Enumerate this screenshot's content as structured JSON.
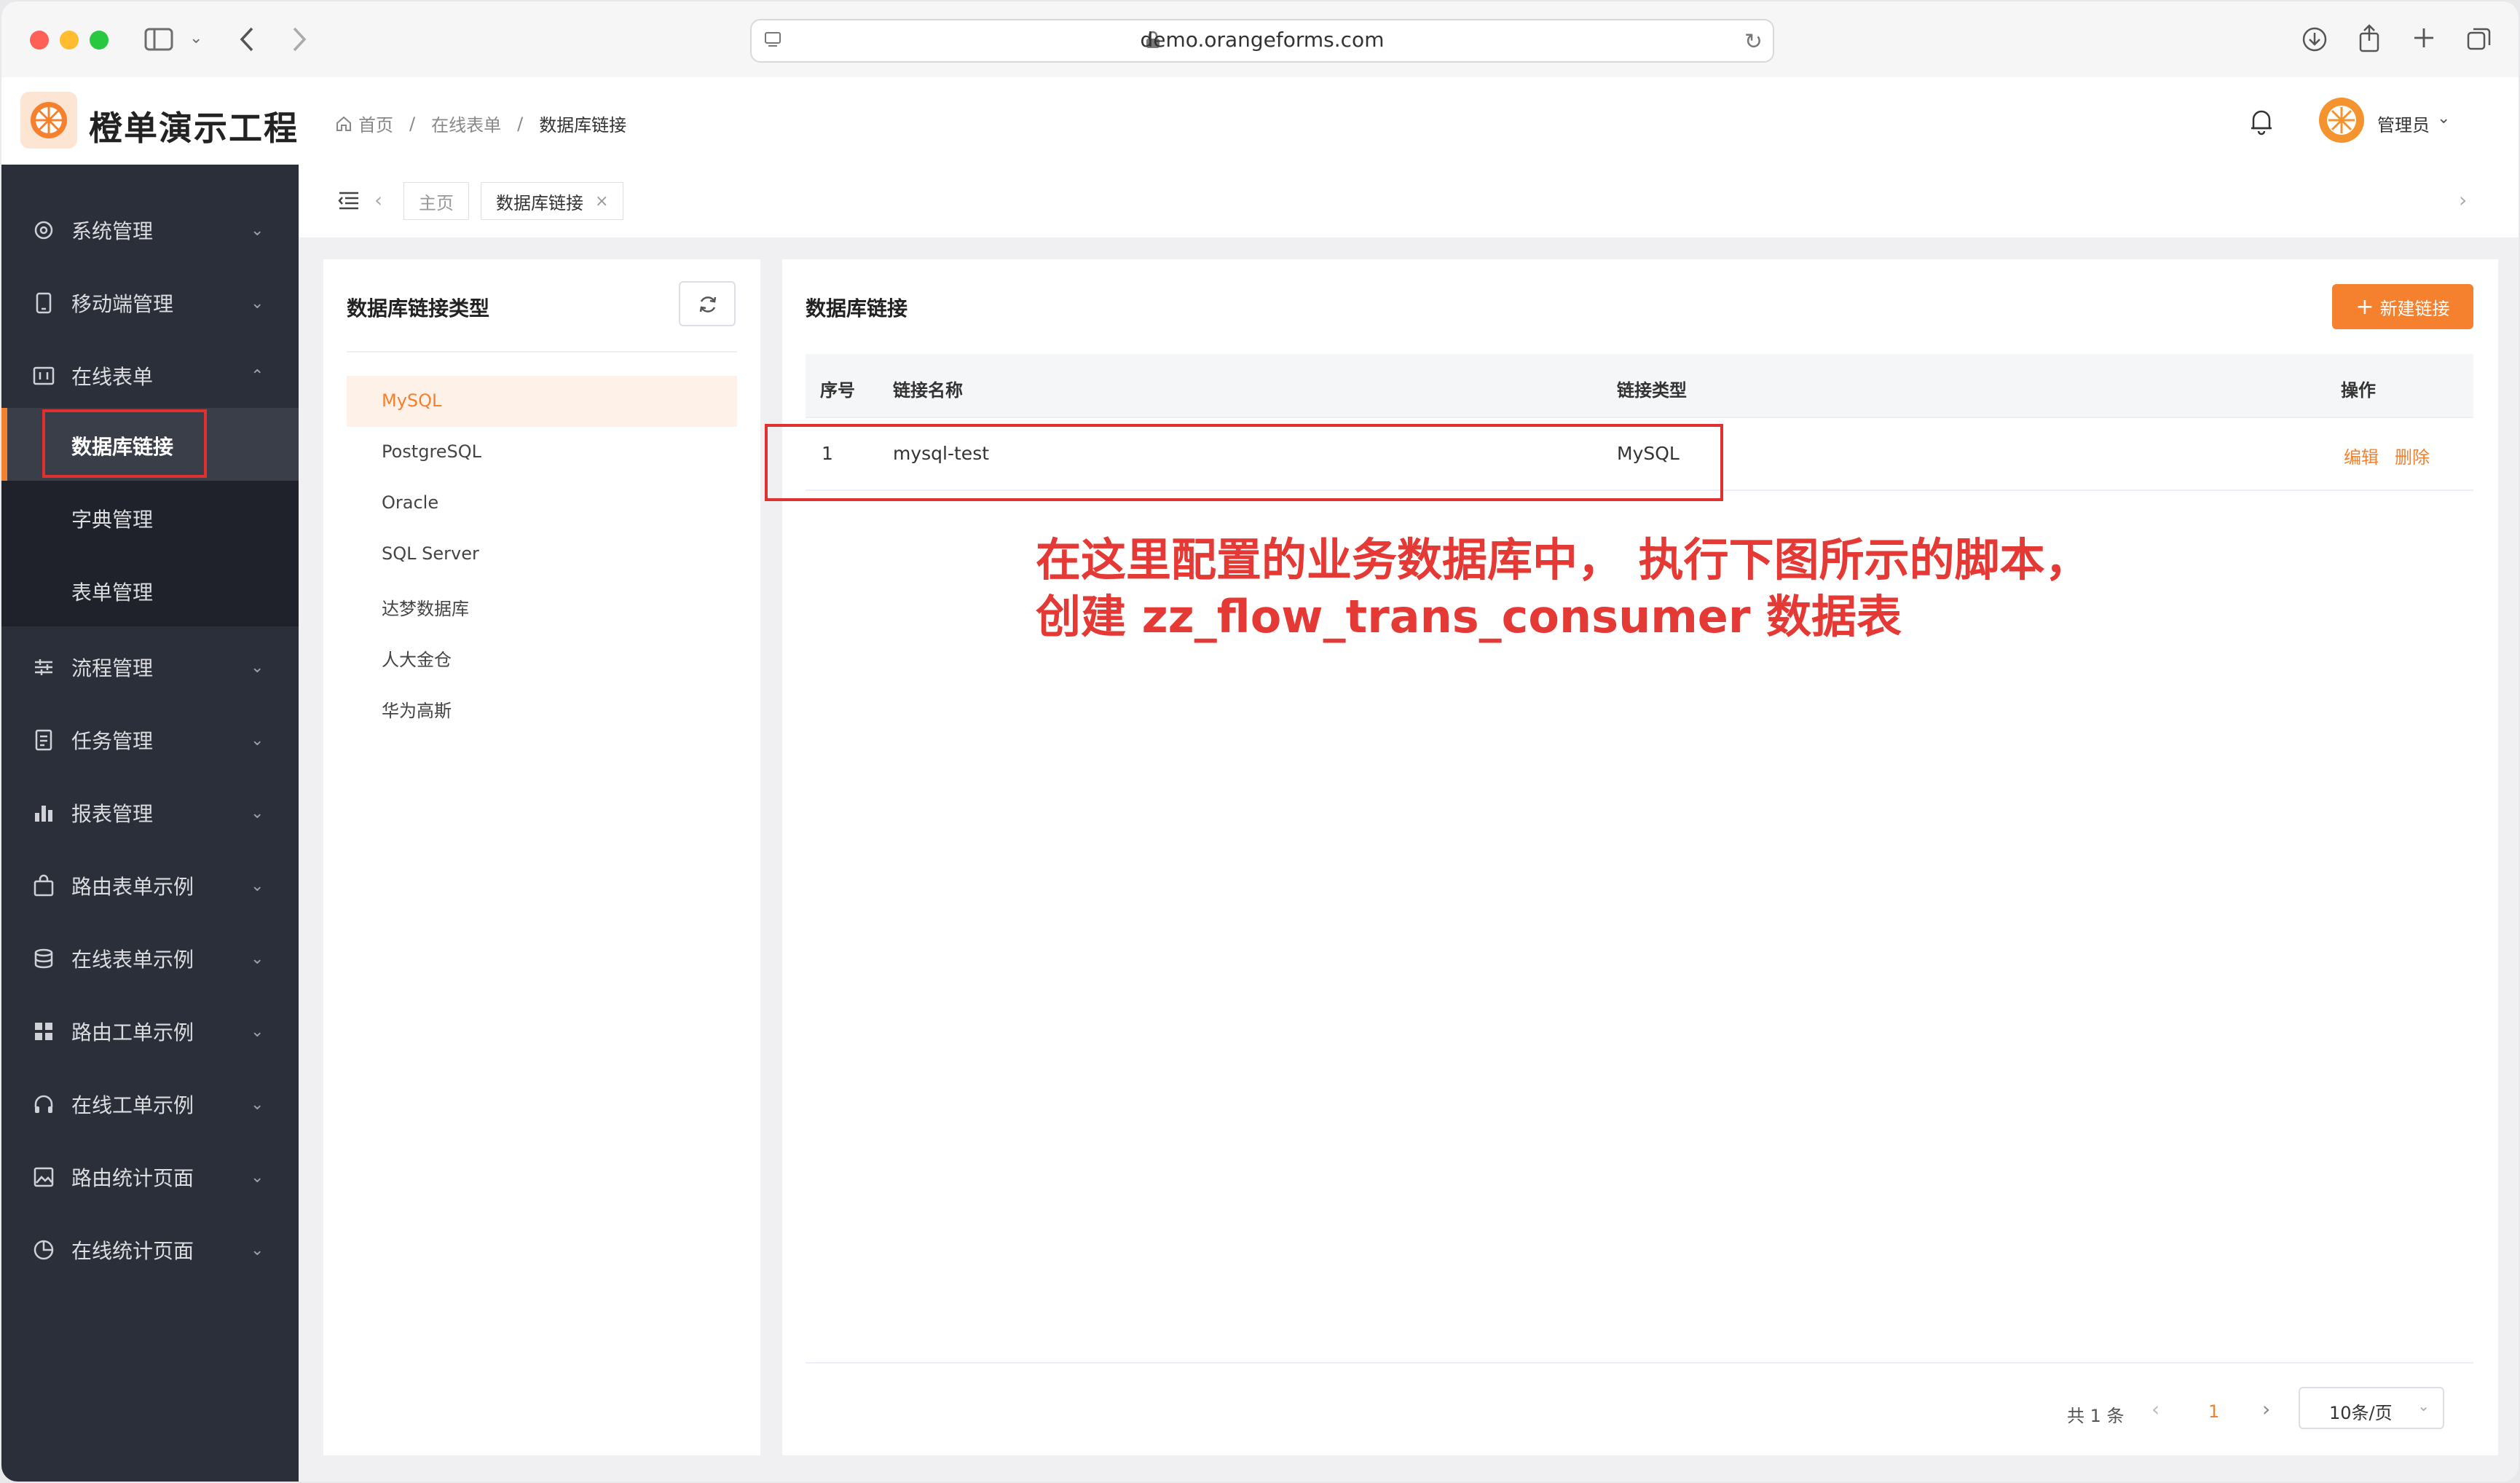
{
  "browser": {
    "url": "demo.orangeforms.com"
  },
  "header": {
    "app_title": "橙单演示工程",
    "breadcrumb": [
      "首页",
      "在线表单",
      "数据库链接"
    ],
    "user": "管理员"
  },
  "sidebar": {
    "items": [
      {
        "label": "系统管理",
        "icon": "gear-icon"
      },
      {
        "label": "移动端管理",
        "icon": "mobile-icon"
      },
      {
        "label": "在线表单",
        "icon": "form-icon",
        "expanded": true
      },
      {
        "label": "流程管理",
        "icon": "sliders-icon"
      },
      {
        "label": "任务管理",
        "icon": "task-icon"
      },
      {
        "label": "报表管理",
        "icon": "bar-chart-icon"
      },
      {
        "label": "路由表单示例",
        "icon": "bag-icon"
      },
      {
        "label": "在线表单示例",
        "icon": "database-icon"
      },
      {
        "label": "路由工单示例",
        "icon": "grid-icon"
      },
      {
        "label": "在线工单示例",
        "icon": "headset-icon"
      },
      {
        "label": "路由统计页面",
        "icon": "image-icon"
      },
      {
        "label": "在线统计页面",
        "icon": "pie-icon"
      }
    ],
    "sub_items": [
      "数据库链接",
      "字典管理",
      "表单管理"
    ],
    "active_sub": "数据库链接"
  },
  "tabs": {
    "home": "主页",
    "current": "数据库链接"
  },
  "left_panel": {
    "title": "数据库链接类型",
    "types": [
      "MySQL",
      "PostgreSQL",
      "Oracle",
      "SQL Server",
      "达梦数据库",
      "人大金仓",
      "华为高斯"
    ],
    "active": "MySQL"
  },
  "main_panel": {
    "title": "数据库链接",
    "new_button": "新建链接",
    "columns": [
      "序号",
      "链接名称",
      "链接类型",
      "操作"
    ],
    "rows": [
      {
        "index": "1",
        "name": "mysql-test",
        "type": "MySQL",
        "edit": "编辑",
        "delete": "删除"
      }
    ],
    "annotation_line1": "在这里配置的业务数据库中，  执行下图所示的脚本，",
    "annotation_line2": "创建 zz_flow_trans_consumer 数据表",
    "pagination": {
      "total": "共 1 条",
      "current_page": "1",
      "page_size": "10条/页"
    }
  },
  "colors": {
    "accent": "#f5802e",
    "sidebar_bg": "#2b2f3a",
    "annotation": "#e53935"
  }
}
